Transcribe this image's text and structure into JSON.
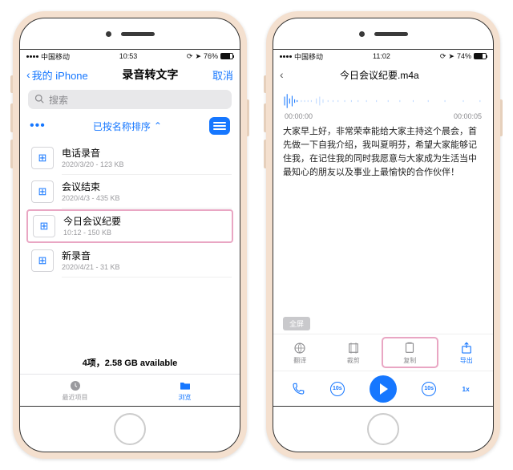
{
  "phone1": {
    "status": {
      "carrier": "中国移动",
      "time": "10:53",
      "battery_pct": "76%",
      "battery_fill": 76
    },
    "nav": {
      "back": "我的 iPhone",
      "title": "录音转文字",
      "cancel": "取消"
    },
    "search_placeholder": "搜索",
    "sort_label": "已按名称排序",
    "files": [
      {
        "name": "电话录音",
        "meta": "2020/3/20 - 123 KB"
      },
      {
        "name": "会议结束",
        "meta": "2020/4/3 - 435 KB"
      },
      {
        "name": "今日会议纪要",
        "meta": "10:12 - 150 KB"
      },
      {
        "name": "新录音",
        "meta": "2020/4/21 - 31 KB"
      }
    ],
    "highlight_index": 2,
    "footer": "4项，2.58 GB available",
    "tabs": {
      "recent": "最近项目",
      "browse": "浏览"
    }
  },
  "phone2": {
    "status": {
      "carrier": "中国移动",
      "time": "11:02",
      "battery_pct": "74%",
      "battery_fill": 74
    },
    "nav_title": "今日会议纪要.m4a",
    "time_start": "00:00:00",
    "time_end": "00:00:05",
    "transcript": "大家早上好，非常荣幸能给大家主持这个晨会，首先做一下自我介绍，我叫夏明芬，希望大家能够记住我，在记住我的同时我愿意与大家成为生活当中最知心的朋友以及事业上最愉快的合作伙伴！",
    "fullscreen": "全屏",
    "tools": [
      {
        "id": "translate",
        "label": "翻译"
      },
      {
        "id": "trim",
        "label": "裁剪"
      },
      {
        "id": "copy",
        "label": "复制"
      },
      {
        "id": "export",
        "label": "导出"
      }
    ],
    "tool_hl_index": 2,
    "skip_back": "10s",
    "skip_fwd": "10s"
  }
}
